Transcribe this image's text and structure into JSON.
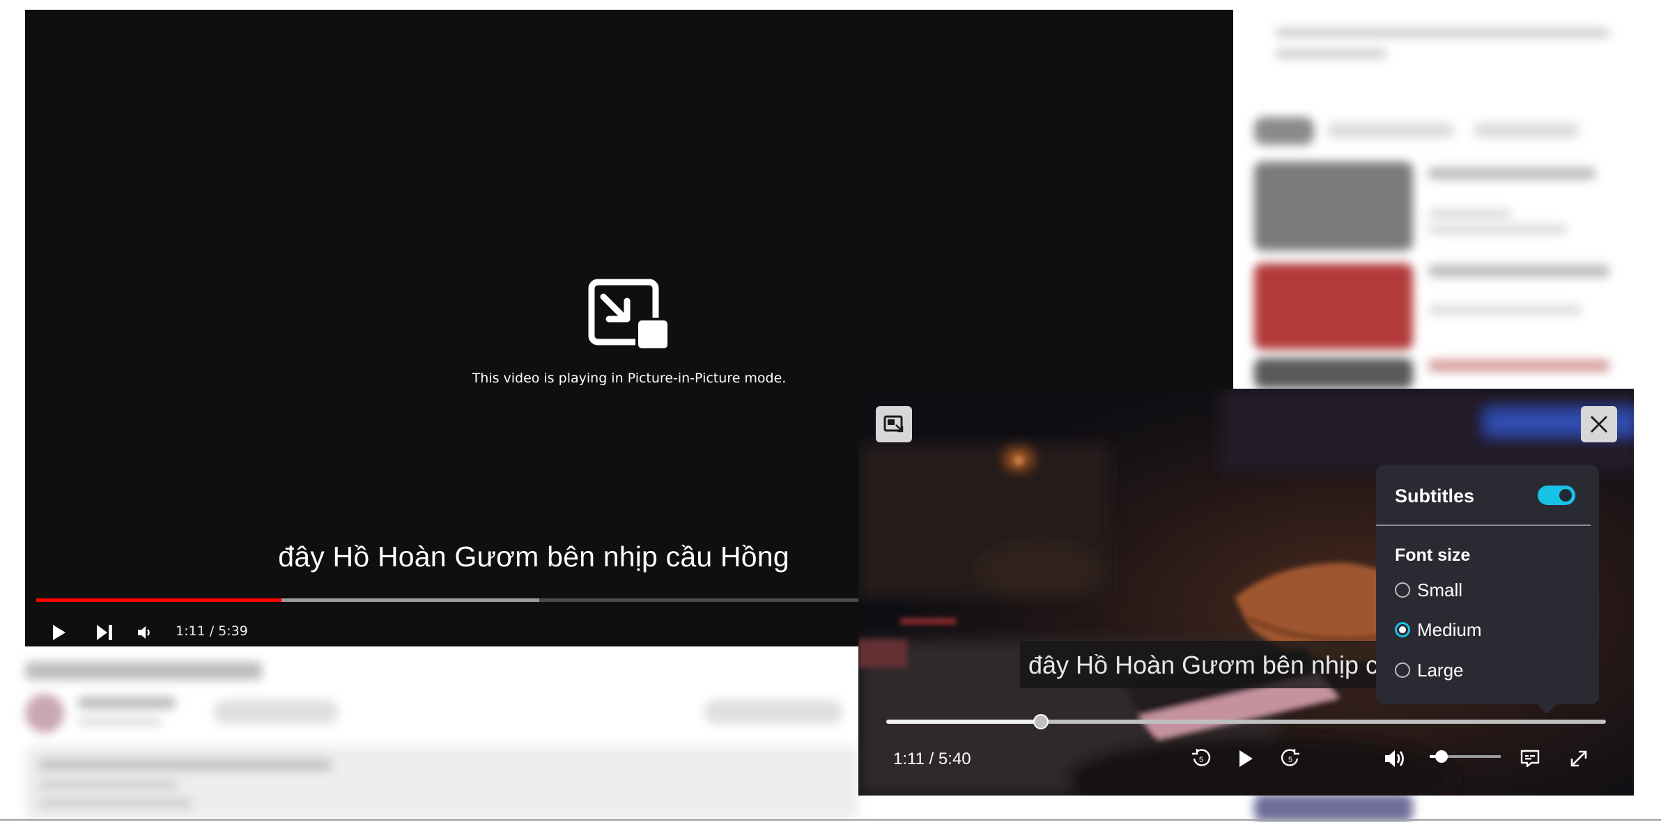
{
  "main_player": {
    "pip_message": "This video is playing in Picture-in-Picture mode.",
    "caption": "đây Hồ Hoàn Gươm bên nhịp cầu Hồng",
    "time": "1:11 / 5:39",
    "progress": {
      "played_fraction": 0.205,
      "buffered_fraction": 0.42,
      "progress_color": "#ff0000"
    }
  },
  "pip_window": {
    "caption": "đây Hồ Hoàn Gươm bên nhịp cầu Hồng",
    "time": "1:11 / 5:40",
    "seek_fraction": 0.215,
    "volume_fraction": 0.17,
    "accent_color": "#17c2e6",
    "subtitles_menu": {
      "title": "Subtitles",
      "enabled": true,
      "font_size_label": "Font size",
      "options": [
        {
          "label": "Small",
          "selected": false
        },
        {
          "label": "Medium",
          "selected": true
        },
        {
          "label": "Large",
          "selected": false
        }
      ]
    },
    "icons": [
      "back-to-tab-icon",
      "close-icon",
      "rewind-5-icon",
      "play-icon",
      "forward-5-icon",
      "volume-icon",
      "subtitles-icon",
      "fullscreen-icon"
    ]
  }
}
